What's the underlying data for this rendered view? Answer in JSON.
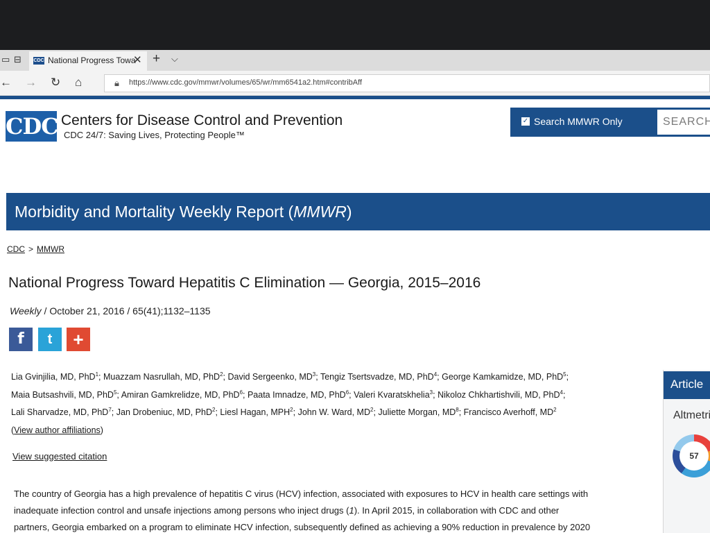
{
  "browser": {
    "tab_title": "National Progress Towa",
    "tab_favicon_text": "CDC",
    "url": "https://www.cdc.gov/mmwr/volumes/65/wr/mm6541a2.htm#contribAff"
  },
  "header": {
    "logo_text": "CDC",
    "org_name": "Centers for Disease Control and Prevention",
    "tagline": "CDC 24/7: Saving Lives, Protecting People™",
    "search_checkbox_label": "Search MMWR Only",
    "search_placeholder": "SEARCH"
  },
  "banner": {
    "title_prefix": "Morbidity and Mortality Weekly Report (",
    "title_italic": "MMWR",
    "title_suffix": ")"
  },
  "breadcrumb": {
    "items": [
      "CDC",
      "MMWR"
    ],
    "separator": ">"
  },
  "article": {
    "title": "National Progress Toward Hepatitis C Elimination — Georgia, 2015–2016",
    "pub_italic": "Weekly",
    "pub_rest": " / October 21, 2016 / 65(41);1132–1135",
    "authors": [
      {
        "name": "Lia Gvinjilia, MD, PhD",
        "sup": "1"
      },
      {
        "name": "Muazzam Nasrullah, MD, PhD",
        "sup": "2"
      },
      {
        "name": "David Sergeenko, MD",
        "sup": "3"
      },
      {
        "name": "Tengiz Tsertsvadze, MD, PhD",
        "sup": "4"
      },
      {
        "name": "George Kamkamidze, MD, PhD",
        "sup": "5"
      },
      {
        "name": "Maia Butsashvili, MD, PhD",
        "sup": "5"
      },
      {
        "name": "Amiran Gamkrelidze, MD, PhD",
        "sup": "6"
      },
      {
        "name": "Paata Imnadze, MD, PhD",
        "sup": "6"
      },
      {
        "name": "Valeri Kvaratskhelia",
        "sup": "3"
      },
      {
        "name": "Nikoloz Chkhartishvili, MD, PhD",
        "sup": "4"
      },
      {
        "name": "Lali Sharvadze, MD, PhD",
        "sup": "7"
      },
      {
        "name": "Jan Drobeniuc, MD, PhD",
        "sup": "2"
      },
      {
        "name": "Liesl Hagan, MPH",
        "sup": "2"
      },
      {
        "name": "John W. Ward, MD",
        "sup": "2"
      },
      {
        "name": "Juliette Morgan, MD",
        "sup": "8"
      },
      {
        "name": "Francisco Averhoff, MD",
        "sup": "2"
      }
    ],
    "affiliations_link": "View author affiliations",
    "citation_link": "View suggested citation",
    "abstract_line1": "The country of Georgia has a high prevalence of hepatitis C virus (HCV) infection, associated with exposures to HCV in health care settings with",
    "abstract_line2a": "inadequate infection control and unsafe injections among persons who inject drugs (",
    "abstract_ref": "1",
    "abstract_line2b": "). In April 2015, in collaboration with CDC and other",
    "abstract_line3": "partners, Georgia embarked on a program to eliminate HCV infection, subsequently defined as achieving a 90% reduction in prevalence by 2020"
  },
  "side_panel": {
    "tab_label": "Article",
    "altmetric_label": "Altmetric",
    "altmetric_score": "57"
  },
  "share": {
    "facebook_glyph": "f",
    "twitter_glyph": "t",
    "more_glyph": "+"
  },
  "colors": {
    "cdc_blue": "#1b4f8a",
    "logo_blue": "#1d5fa8",
    "facebook": "#3b5a98",
    "twitter": "#2aa3d8",
    "addthis": "#e04a32"
  }
}
